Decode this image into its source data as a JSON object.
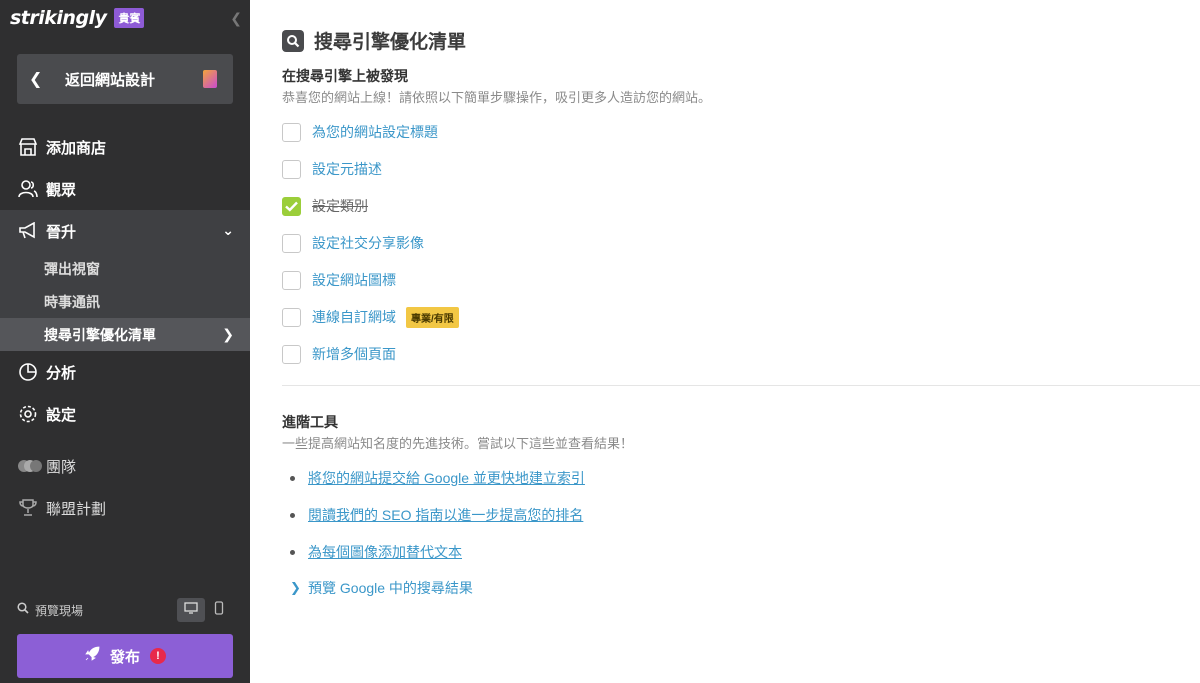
{
  "sidebar": {
    "logo": "strikingly",
    "plan_badge": "貴賓",
    "back_button": "返回網站設計",
    "nav": {
      "add_store": "添加商店",
      "audience": "觀眾",
      "promote": "晉升",
      "promote_sub": [
        "彈出視窗",
        "時事通訊",
        "搜尋引擎優化清單"
      ],
      "analytics": "分析",
      "settings": "設定",
      "team": "團隊",
      "affiliate": "聯盟計劃"
    },
    "preview_label": "預覽現場",
    "publish_label": "發布",
    "publish_alert": "!"
  },
  "main": {
    "title": "搜尋引擎優化清單",
    "section1": {
      "heading": "在搜尋引擎上被發現",
      "desc": "恭喜您的網站上線！請依照以下簡單步驟操作，吸引更多人造訪您的網站。",
      "items": [
        {
          "label": "為您的網站設定標題",
          "checked": false
        },
        {
          "label": "設定元描述",
          "checked": false
        },
        {
          "label": "設定類別",
          "checked": true
        },
        {
          "label": "設定社交分享影像",
          "checked": false
        },
        {
          "label": "設定網站圖標",
          "checked": false
        },
        {
          "label": "連線自訂網域",
          "checked": false,
          "badge": "專業/有限"
        },
        {
          "label": "新增多個頁面",
          "checked": false
        }
      ]
    },
    "section2": {
      "heading": "進階工具",
      "desc": "一些提高網站知名度的先進技術。嘗試以下這些並查看結果！",
      "links": [
        "將您的網站提交給 Google 並更快地建立索引",
        "閱讀我們的 SEO 指南以進一步提高您的排名",
        "為每個圖像添加替代文本"
      ],
      "expand": "預覽 Google 中的搜尋結果"
    }
  },
  "colors": {
    "sidebar_bg": "#2f2f30",
    "accent_purple": "#8c5fd6",
    "link_blue": "#3b97c9",
    "check_green": "#9bce3a",
    "badge_yellow": "#f2c744"
  }
}
